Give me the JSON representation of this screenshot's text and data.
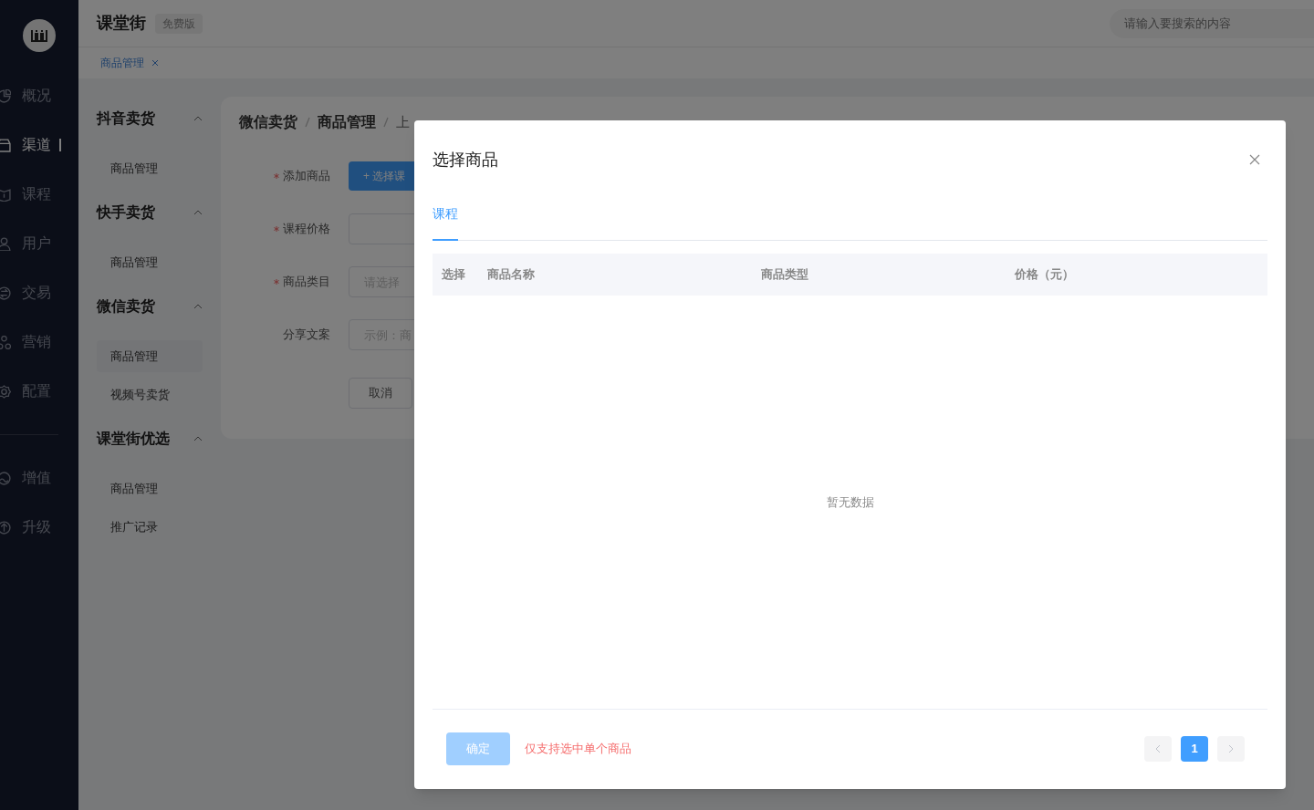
{
  "header": {
    "brand": "课堂街",
    "edition": "免费版",
    "search": {
      "placeholder": "请输入要搜索的内容"
    }
  },
  "nav": {
    "items": [
      {
        "label": "概况",
        "selected": false
      },
      {
        "label": "渠道",
        "selected": true
      },
      {
        "label": "课程",
        "selected": false
      },
      {
        "label": "用户",
        "selected": false
      },
      {
        "label": "交易",
        "selected": false
      },
      {
        "label": "营销",
        "selected": false
      },
      {
        "label": "配置",
        "selected": false
      }
    ],
    "extra_items": [
      {
        "label": "增值",
        "selected": false
      },
      {
        "label": "升级",
        "selected": false
      }
    ]
  },
  "page_tabs": [
    {
      "label": "商品管理",
      "selected": true
    }
  ],
  "submenu": [
    {
      "title": "抖音卖货",
      "expanded": true,
      "items": [
        {
          "label": "商品管理",
          "selected": false
        }
      ]
    },
    {
      "title": "快手卖货",
      "expanded": true,
      "items": [
        {
          "label": "商品管理",
          "selected": false
        }
      ]
    },
    {
      "title": "微信卖货",
      "expanded": true,
      "items": [
        {
          "label": "商品管理",
          "selected": true
        },
        {
          "label": "视频号卖货",
          "selected": false
        }
      ]
    },
    {
      "title": "课堂街优选",
      "expanded": true,
      "items": [
        {
          "label": "商品管理",
          "selected": false
        },
        {
          "label": "推广记录",
          "selected": false
        }
      ]
    }
  ],
  "breadcrumb": [
    "微信卖货",
    "商品管理",
    "上"
  ],
  "form": {
    "fields": [
      {
        "kind": "button",
        "label": "添加商品",
        "required": true,
        "value": "+ 选择课"
      },
      {
        "kind": "input",
        "label": "课程价格",
        "required": true
      },
      {
        "kind": "select",
        "label": "商品类目",
        "required": true,
        "placeholder": "请选择"
      },
      {
        "kind": "input",
        "label": "分享文案",
        "required": false,
        "placeholder": "示例：商"
      }
    ],
    "cancel": "取消"
  },
  "modal": {
    "title": "选择商品",
    "tabs": [
      {
        "label": "课程",
        "selected": true
      }
    ],
    "table": {
      "columns": [
        "选择",
        "商品名称",
        "商品类型",
        "价格（元）"
      ],
      "empty_text": "暂无数据"
    },
    "confirm": {
      "label": "确定",
      "disabled": true
    },
    "note": "仅支持选中单个商品",
    "pagination": {
      "prev_disabled": true,
      "next_disabled": true,
      "pages": [
        {
          "label": "1",
          "selected": true
        }
      ]
    }
  }
}
